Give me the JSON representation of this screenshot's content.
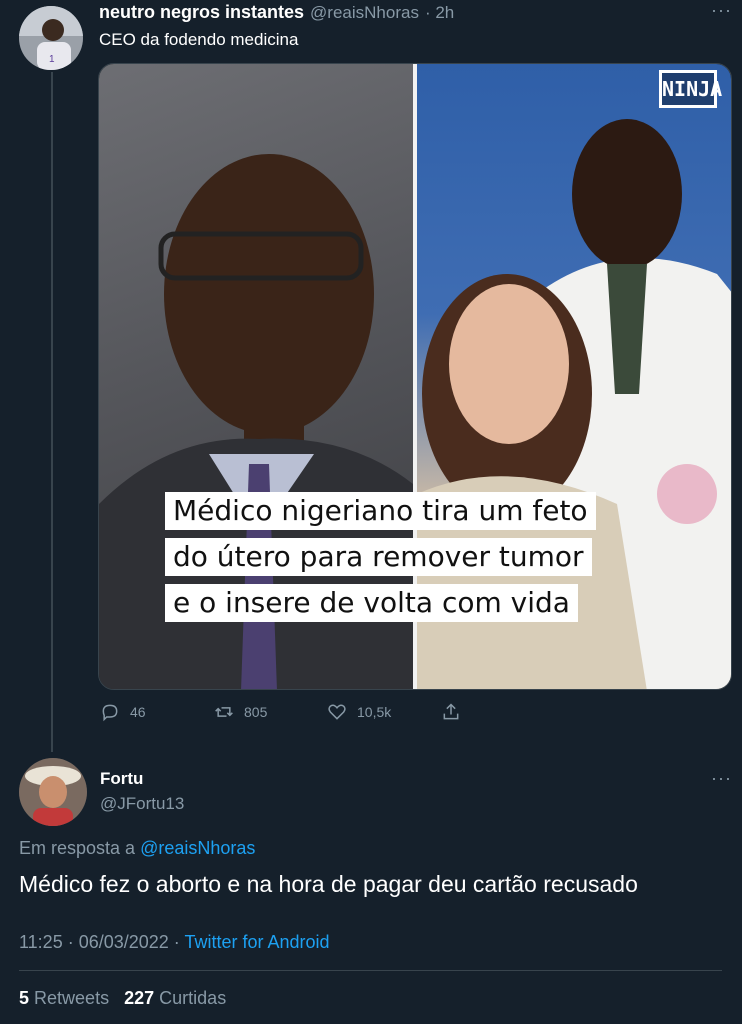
{
  "tweet1": {
    "name": "neutro negros instantes",
    "handle": "@reaisNhoras",
    "time": "· 2h",
    "text": "CEO da fodendo medicina",
    "media": {
      "caption_lines": [
        "Médico nigeriano tira um feto",
        "do útero para remover tumor",
        "e o insere de volta com vida"
      ],
      "watermark": "NINJA"
    },
    "actions": {
      "replies": "46",
      "retweets": "805",
      "likes": "10,5k"
    }
  },
  "tweet2": {
    "name": "Fortu",
    "handle": "@JFortu13",
    "reply_prefix": "Em resposta a",
    "reply_to": "@reaisNhoras",
    "text": "Médico fez o aborto e na hora de pagar deu cartão recusado",
    "timestamp": "11:25 · 06/03/2022 ·",
    "client": "Twitter for Android",
    "stats": {
      "retweets_count": "5",
      "retweets_label": "Retweets",
      "likes_count": "227",
      "likes_label": "Curtidas"
    }
  },
  "colors": {
    "background": "#15202b",
    "muted": "#8899a6",
    "link": "#1da1f2",
    "border": "#38444d"
  }
}
